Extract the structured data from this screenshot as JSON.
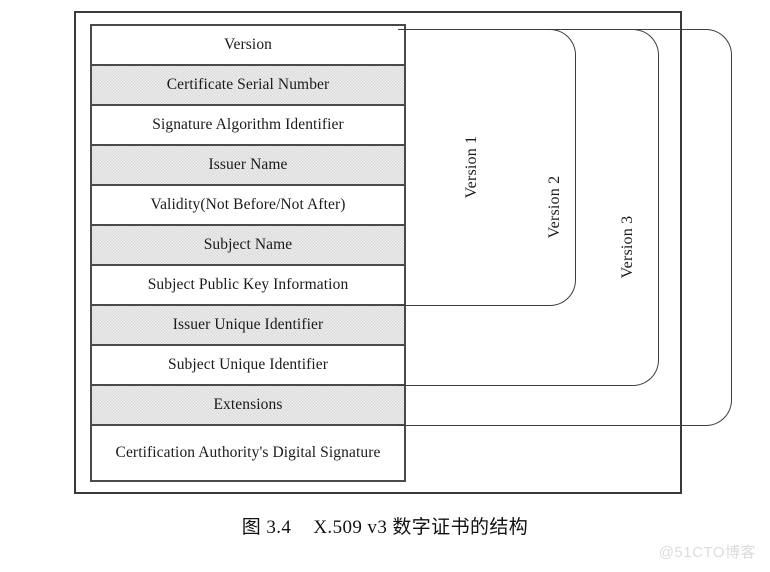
{
  "figure": {
    "caption_label": "图 3.4",
    "caption_title": "X.509 v3 数字证书的结构"
  },
  "certificate_table": {
    "rows": [
      {
        "label": "Version",
        "shaded": false
      },
      {
        "label": "Certificate Serial Number",
        "shaded": true
      },
      {
        "label": "Signature Algorithm Identifier",
        "shaded": false
      },
      {
        "label": "Issuer Name",
        "shaded": true
      },
      {
        "label": "Validity(Not Before/Not After)",
        "shaded": false
      },
      {
        "label": "Subject Name",
        "shaded": true
      },
      {
        "label": "Subject Public Key Information",
        "shaded": false
      },
      {
        "label": "Issuer Unique Identifier",
        "shaded": true
      },
      {
        "label": "Subject Unique Identifier",
        "shaded": false
      },
      {
        "label": "Extensions",
        "shaded": true
      },
      {
        "label": "Certification Authority's Digital Signature",
        "shaded": false
      }
    ]
  },
  "version_brackets": [
    {
      "label": "Version 1",
      "covers_through_row": "Subject Public Key Information"
    },
    {
      "label": "Version 2",
      "covers_through_row": "Subject Unique Identifier"
    },
    {
      "label": "Version 3",
      "covers_through_row": "Extensions"
    }
  ],
  "watermark": {
    "text": "@51CTO博客"
  },
  "colors": {
    "page_background": "#ffffff",
    "frame_border": "#3a3a3a",
    "table_border": "#4a4a4a",
    "row_shading": "#d9d9d9",
    "bracket_stroke": "#3d3d3d",
    "text": "#1a1a1a",
    "watermark": "#dcdcdc"
  }
}
